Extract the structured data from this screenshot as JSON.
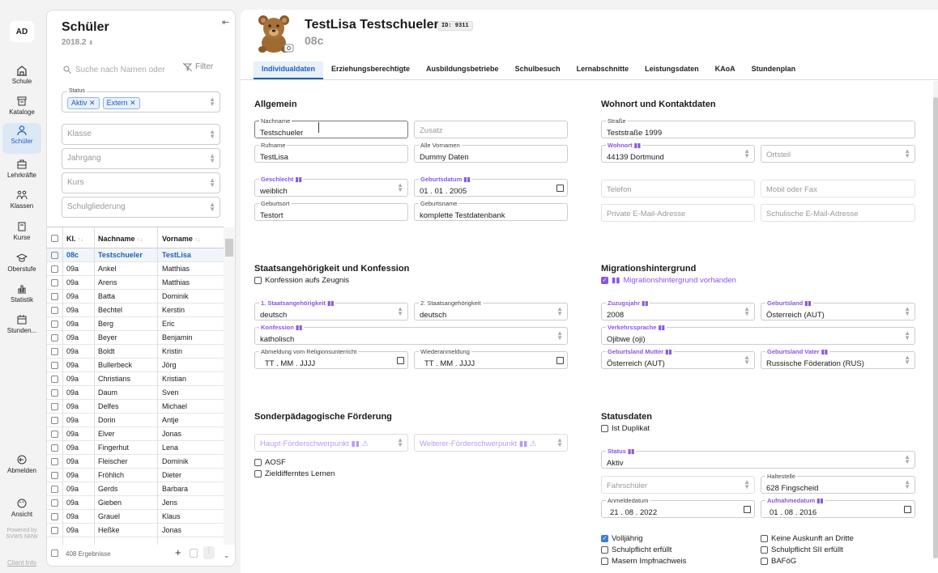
{
  "nav": {
    "avatar": "AD",
    "items": [
      {
        "label": "Schule"
      },
      {
        "label": "Kataloge"
      },
      {
        "label": "Schüler"
      },
      {
        "label": "Lehrkräfte"
      },
      {
        "label": "Klassen"
      },
      {
        "label": "Kurse"
      },
      {
        "label": "Oberstufe"
      },
      {
        "label": "Statistik"
      },
      {
        "label": "Stunden..."
      }
    ],
    "logout": "Abmelden",
    "view": "Ansicht",
    "powered": "Powered by SVWS NRW",
    "client_info": "Client Info"
  },
  "list": {
    "title": "Schüler",
    "year": "2018.2",
    "search_placeholder": "Suche nach Namen oder",
    "filter": "Filter",
    "status_label": "Status",
    "status_chips": [
      "Aktiv",
      "Extern"
    ],
    "klasse": "Klasse",
    "jahrgang": "Jahrgang",
    "kurs": "Kurs",
    "schulgliederung": "Schulgliederung",
    "columns": [
      "Kl.",
      "Nachname",
      "Vorname"
    ],
    "rows": [
      [
        "08c",
        "Testschueler",
        "TestLisa"
      ],
      [
        "09a",
        "Ankel",
        "Matthias"
      ],
      [
        "09a",
        "Arens",
        "Matthias"
      ],
      [
        "09a",
        "Batta",
        "Dominik"
      ],
      [
        "09a",
        "Bechtel",
        "Kerstin"
      ],
      [
        "09a",
        "Berg",
        "Eric"
      ],
      [
        "09a",
        "Beyer",
        "Benjamin"
      ],
      [
        "09a",
        "Boldt",
        "Kristin"
      ],
      [
        "09a",
        "Bullerbeck",
        "Jörg"
      ],
      [
        "09a",
        "Christians",
        "Kristian"
      ],
      [
        "09a",
        "Daum",
        "Sven"
      ],
      [
        "09a",
        "Delfes",
        "Michael"
      ],
      [
        "09a",
        "Dorin",
        "Antje"
      ],
      [
        "09a",
        "Elver",
        "Jonas"
      ],
      [
        "09a",
        "Fingerhut",
        "Lena"
      ],
      [
        "09a",
        "Fleischer",
        "Dominik"
      ],
      [
        "09a",
        "Fröhlich",
        "Dieter"
      ],
      [
        "09a",
        "Gerds",
        "Barbara"
      ],
      [
        "09a",
        "Gieben",
        "Jens"
      ],
      [
        "09a",
        "Grauel",
        "Klaus"
      ],
      [
        "09a",
        "Heßke",
        "Jonas"
      ]
    ],
    "result_count": "408 Ergebnisse"
  },
  "student": {
    "name": "TestLisa Testschueler",
    "id": "ID: 9311",
    "klasse": "08c"
  },
  "tabs": [
    "Individualdaten",
    "Erziehungsberechtigte",
    "Ausbildungsbetriebe",
    "Schulbesuch",
    "Lernabschnitte",
    "Leistungsdaten",
    "KAoA",
    "Stundenplan"
  ],
  "allgemein": {
    "title": "Allgemein",
    "nachname_label": "Nachname",
    "nachname": "Testschueler",
    "zusatz": "Zusatz",
    "rufname_label": "Rufname",
    "rufname": "TestLisa",
    "vornamen_label": "Alle Vornamen",
    "vornamen": "Dummy Daten",
    "geschlecht_label": "Geschlecht",
    "geschlecht": "weiblich",
    "geburtsdatum_label": "Geburtsdatum",
    "geburtsdatum": "01 . 01 . 2005",
    "geburtsort_label": "Geburtsort",
    "geburtsort": "Testort",
    "geburtsname_label": "Geburtsname",
    "geburtsname": "komplette Testdatenbank"
  },
  "wohnort": {
    "title": "Wohnort und Kontaktdaten",
    "strasse_label": "Straße",
    "strasse": "Teststraße 1999",
    "wohnort_label": "Wohnort",
    "wohnort": "44139 Dortmund",
    "ortsteil": "Ortsteil",
    "telefon": "Telefon",
    "mobil": "Mobil oder Fax",
    "private_mail": "Private E-Mail-Adresse",
    "schul_mail": "Schulische E-Mail-Adresse"
  },
  "staat": {
    "title": "Staatsangehörigkeit und Konfession",
    "konf_zeugnis": "Konfession aufs Zeugnis",
    "sa1_label": "1. Staatsangehörigkeit",
    "sa1": "deutsch",
    "sa2_label": "2. Staatsangehörigkeit",
    "sa2": "deutsch",
    "konf_label": "Konfession",
    "konf": "katholisch",
    "abm_label": "Abmeldung vom Religionsunterricht",
    "abm": "TT . MM . JJJJ",
    "wied_label": "Wiederanmeldung",
    "wied": "TT . MM . JJJJ"
  },
  "migration": {
    "title": "Migrationshintergrund",
    "vorhanden": "Migrationshintergrund vorhanden",
    "zuzug_label": "Zuzugsjahr",
    "zuzug": "2008",
    "gebland_label": "Geburtsland",
    "gebland": "Österreich (AUT)",
    "sprache_label": "Verkehrssprache",
    "sprache": "Ojibwe (oji)",
    "mutter_label": "Geburtsland Mutter",
    "mutter": "Österreich (AUT)",
    "vater_label": "Geburtsland Vater",
    "vater": "Russische Föderation (RUS)"
  },
  "sonder": {
    "title": "Sonderpädagogische Förderung",
    "haupt": "Haupt-Förderschwerpunkt",
    "weiterer": "Weiterer-Förderschwerpunkt",
    "aosf": "AOSF",
    "ziel": "Zieldifferntes Lernen"
  },
  "status": {
    "title": "Statusdaten",
    "duplikat": "Ist Duplikat",
    "status_label": "Status",
    "status": "Aktiv",
    "fahrschueler": "Fahrschüler",
    "halt_label": "Haltestelle",
    "halt": "628 Fingscheid",
    "anm_label": "Anmeldedatum",
    "anm": "21 . 08 . 2022",
    "auf_label": "Aufnahmedatum",
    "auf": "01 . 08 . 2016",
    "volljaehrig": "Volljährig",
    "keine_auskunft": "Keine Auskunft an Dritte",
    "schulpflicht": "Schulpflicht erfüllt",
    "schulpflicht2": "Schulpflicht SII erfüllt",
    "masern": "Masern Impfnachweis",
    "bafoeg": "BAFöG"
  }
}
